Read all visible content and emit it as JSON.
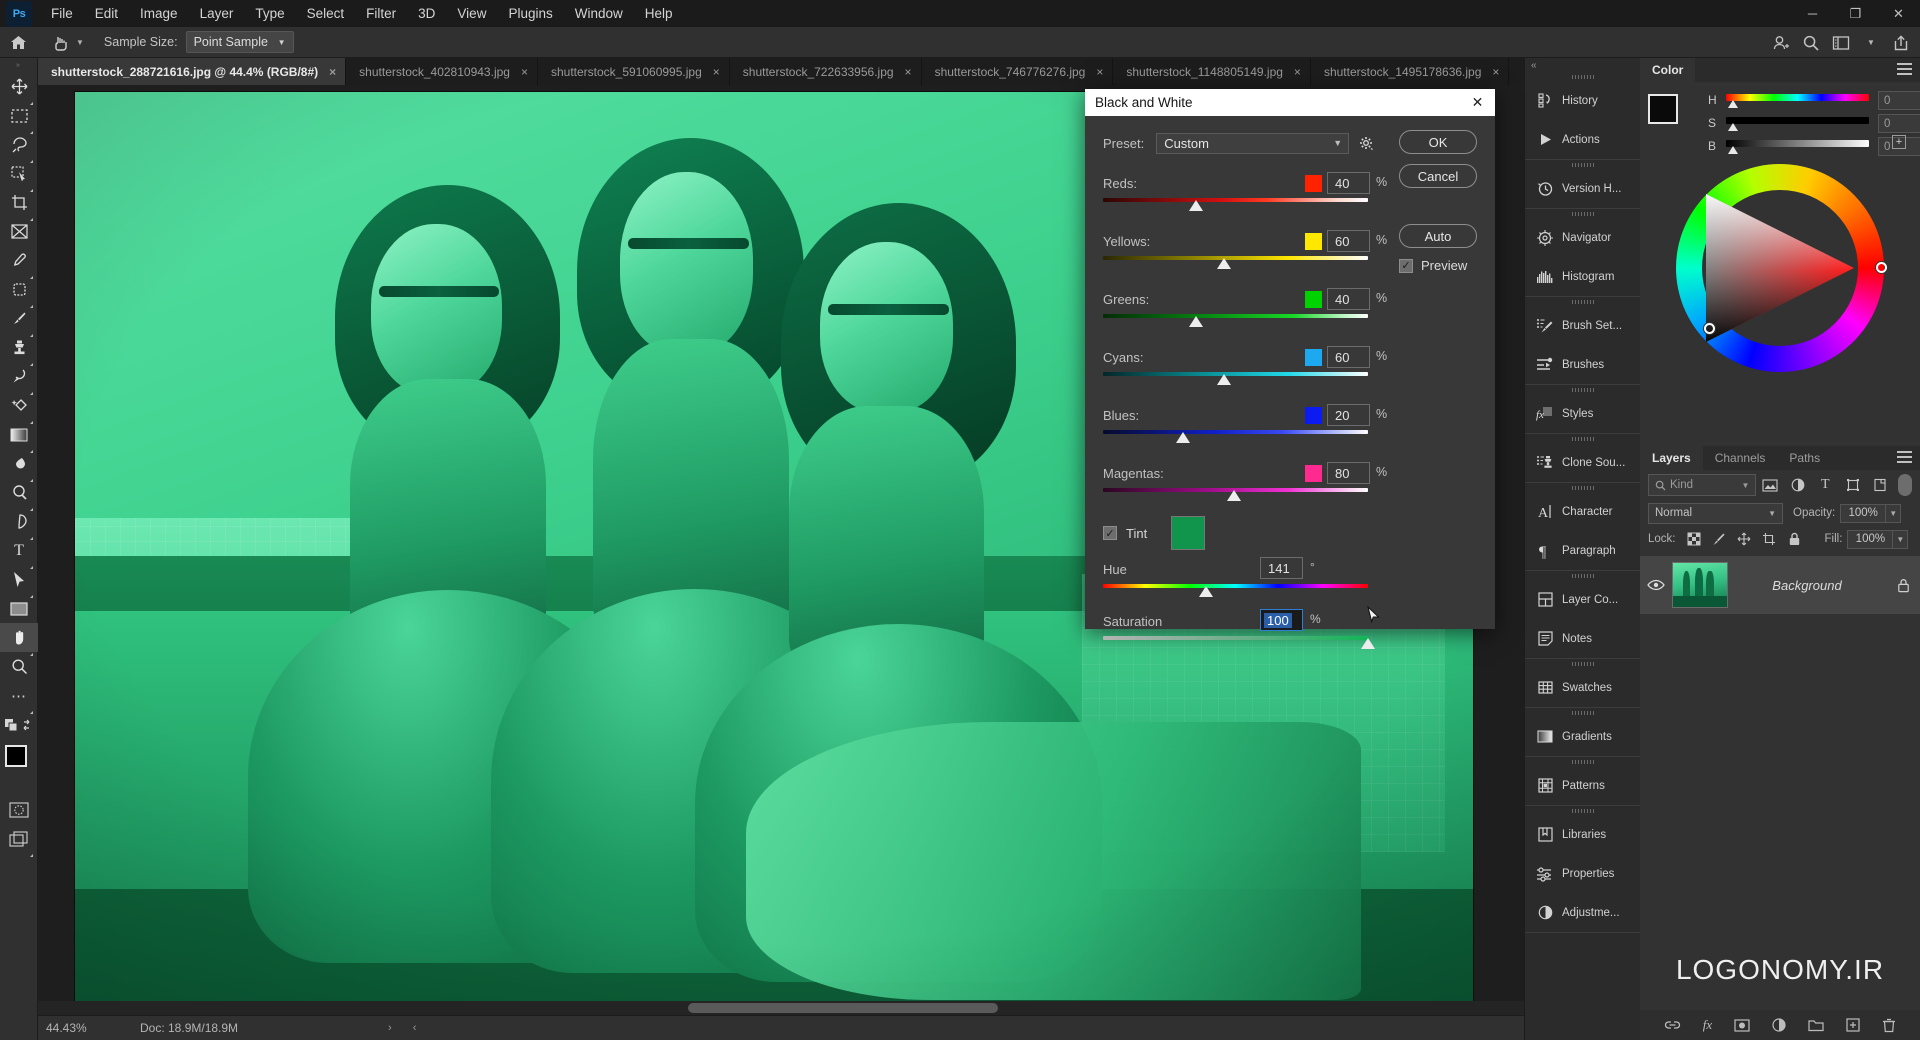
{
  "app": {
    "logo": "Ps",
    "menus": [
      "File",
      "Edit",
      "Image",
      "Layer",
      "Type",
      "Select",
      "Filter",
      "3D",
      "View",
      "Plugins",
      "Window",
      "Help"
    ],
    "window_controls": [
      "minimize-icon",
      "restore-icon",
      "close-icon"
    ]
  },
  "options_bar": {
    "home_icon": "home-icon",
    "tool_icon": "eyedropper-hand-icon",
    "sample_size_label": "Sample Size:",
    "sample_size_value": "Point Sample",
    "right_icons": [
      "user-add-icon",
      "search-icon",
      "workspace-icon",
      "chevron-down-icon",
      "share-icon"
    ]
  },
  "tabs": [
    {
      "label": "shutterstock_288721616.jpg @ 44.4% (RGB/8#)",
      "active": true,
      "close": "×"
    },
    {
      "label": "shutterstock_402810943.jpg",
      "active": false,
      "close": "×"
    },
    {
      "label": "shutterstock_591060995.jpg",
      "active": false,
      "close": "×"
    },
    {
      "label": "shutterstock_722633956.jpg",
      "active": false,
      "close": "×"
    },
    {
      "label": "shutterstock_746776276.jpg",
      "active": false,
      "close": "×"
    },
    {
      "label": "shutterstock_1148805149.jpg",
      "active": false,
      "close": "×"
    },
    {
      "label": "shutterstock_1495178636.jpg",
      "active": false,
      "close": "×"
    }
  ],
  "toolbar": {
    "tools": [
      {
        "name": "move-tool",
        "glyph": "✥",
        "sub": true,
        "selected": false
      },
      {
        "name": "rectangular-marquee-tool",
        "glyph": "⬚",
        "sub": true,
        "selected": false
      },
      {
        "name": "lasso-tool",
        "glyph": "☄",
        "sub": true,
        "selected": false
      },
      {
        "name": "object-selection-tool",
        "glyph": "⬚",
        "sub": true,
        "selected": false
      },
      {
        "name": "crop-tool",
        "glyph": "⌙",
        "sub": true,
        "selected": false
      },
      {
        "name": "frame-tool",
        "glyph": "⊠",
        "sub": false,
        "selected": false
      },
      {
        "name": "eyedropper-tool",
        "glyph": "✒",
        "sub": true,
        "selected": false
      },
      {
        "name": "spot-healing-brush-tool",
        "glyph": "⬚",
        "sub": true,
        "selected": false
      },
      {
        "name": "brush-tool",
        "glyph": "✎",
        "sub": true,
        "selected": false
      },
      {
        "name": "clone-stamp-tool",
        "glyph": "♟",
        "sub": true,
        "selected": false
      },
      {
        "name": "history-brush-tool",
        "glyph": "➰",
        "sub": true,
        "selected": false
      },
      {
        "name": "eraser-tool",
        "glyph": "✦",
        "sub": true,
        "selected": false
      },
      {
        "name": "gradient-tool",
        "glyph": "■",
        "sub": true,
        "selected": false
      },
      {
        "name": "blur-tool",
        "glyph": "◖",
        "sub": true,
        "selected": false
      },
      {
        "name": "dodge-tool",
        "glyph": "◔",
        "sub": true,
        "selected": false
      },
      {
        "name": "pen-tool",
        "glyph": "✒",
        "sub": true,
        "selected": false
      },
      {
        "name": "horizontal-type-tool",
        "glyph": "T",
        "sub": true,
        "selected": false
      },
      {
        "name": "path-selection-tool",
        "glyph": "➤",
        "sub": true,
        "selected": false
      },
      {
        "name": "rectangle-tool",
        "glyph": "▬",
        "sub": true,
        "selected": false
      },
      {
        "name": "hand-tool",
        "glyph": "✋",
        "sub": true,
        "selected": true
      },
      {
        "name": "zoom-tool",
        "glyph": "⚲",
        "sub": false,
        "selected": false
      },
      {
        "name": "edit-toolbar-ellipsis",
        "glyph": "…",
        "sub": true,
        "selected": false
      }
    ],
    "foreground_color": "#000000",
    "background_color": "#ffffff",
    "quick_mask_icon": "quick-mask-icon",
    "screen_mode_icon": "screen-mode-icon"
  },
  "dialog": {
    "title": "Black and White",
    "close_glyph": "✕",
    "preset_label": "Preset:",
    "preset_value": "Custom",
    "gear_icon": "gear-icon",
    "buttons": {
      "ok": "OK",
      "cancel": "Cancel",
      "auto": "Auto"
    },
    "preview_label": "Preview",
    "preview_checked": true,
    "channels": [
      {
        "label": "Reds:",
        "value": "40",
        "unit": "%",
        "chip": "#ff2200",
        "pos_pct": 35,
        "gradient": "linear-gradient(90deg,#2b0505,#d41010 45%,#ff3b24 62%,#ffd6cc 88%,#ffffff)"
      },
      {
        "label": "Yellows:",
        "value": "60",
        "unit": "%",
        "chip": "#ffe800",
        "pos_pct": 46,
        "gradient": "linear-gradient(90deg,#2a2705,#8f8500 35%,#ffe600 70%,#fff6b0 90%,#ffffff)"
      },
      {
        "label": "Greens:",
        "value": "40",
        "unit": "%",
        "chip": "#00d200",
        "pos_pct": 35,
        "gradient": "linear-gradient(90deg,#032b06,#068b12 40%,#18d827 72%,#c5f7cc 92%,#ffffff)"
      },
      {
        "label": "Cyans:",
        "value": "60",
        "unit": "%",
        "chip": "#1ca9f0",
        "pos_pct": 46,
        "gradient": "linear-gradient(90deg,#042628,#0a8d93 38%,#22d8e8 70%,#c3f4f8 92%,#ffffff)"
      },
      {
        "label": "Blues:",
        "value": "20",
        "unit": "%",
        "chip": "#0c1cf0",
        "pos_pct": 30,
        "gradient": "linear-gradient(90deg,#060a2c,#1020c8 42%,#3a4bf5 68%,#ccd2fb 92%,#ffffff)"
      },
      {
        "label": "Magentas:",
        "value": "80",
        "unit": "%",
        "chip": "#ff2a8f",
        "pos_pct": 50,
        "gradient": "linear-gradient(90deg,#2a0620,#a00c8a 40%,#f032d4 70%,#fbcaf2 92%,#ffffff)"
      }
    ],
    "tint": {
      "label": "Tint",
      "checked": true,
      "swatch_color": "#11954c"
    },
    "hue": {
      "label": "Hue",
      "value": "141",
      "unit": "°",
      "pos_pct": 39,
      "gradient": "linear-gradient(90deg,#ff0000,#ffff00 16%,#00ff00 33%,#00ffff 50%,#0000ff 66%,#ff00ff 83%,#ff0000)"
    },
    "saturation": {
      "label": "Saturation",
      "value": "100",
      "unit": "%",
      "pos_pct": 100,
      "gradient": "linear-gradient(90deg,#b4b4b4,#6fae8c 50%,#11b557 100%)"
    }
  },
  "dock_rail": {
    "collapse_icon": "double-chevron-right-icon",
    "groups": [
      [
        {
          "label": "History",
          "icon": "history-icon"
        },
        {
          "label": "Actions",
          "icon": "actions-play-icon"
        }
      ],
      [
        {
          "label": "Version H...",
          "icon": "version-history-icon"
        }
      ],
      [
        {
          "label": "Navigator",
          "icon": "navigator-icon"
        },
        {
          "label": "Histogram",
          "icon": "histogram-icon"
        }
      ],
      [
        {
          "label": "Brush Set...",
          "icon": "brush-settings-icon"
        },
        {
          "label": "Brushes",
          "icon": "brushes-icon"
        }
      ],
      [
        {
          "label": "Styles",
          "icon": "styles-fx-icon"
        }
      ],
      [
        {
          "label": "Clone Sou...",
          "icon": "clone-source-icon"
        }
      ],
      [
        {
          "label": "Character",
          "icon": "character-icon"
        },
        {
          "label": "Paragraph",
          "icon": "paragraph-icon"
        }
      ],
      [
        {
          "label": "Layer Co...",
          "icon": "layer-comps-icon"
        },
        {
          "label": "Notes",
          "icon": "notes-icon"
        }
      ],
      [
        {
          "label": "Swatches",
          "icon": "swatches-grid-icon"
        }
      ],
      [
        {
          "label": "Gradients",
          "icon": "gradients-icon"
        }
      ],
      [
        {
          "label": "Patterns",
          "icon": "patterns-icon"
        }
      ],
      [
        {
          "label": "Libraries",
          "icon": "libraries-icon"
        },
        {
          "label": "Properties",
          "icon": "properties-icon"
        },
        {
          "label": "Adjustme...",
          "icon": "adjustments-icon"
        }
      ]
    ]
  },
  "color_panel": {
    "tab": "Color",
    "menu_icon": "panel-menu-icon",
    "foreground": "#0a0a0a",
    "background": "#ffffff",
    "sliders": [
      {
        "label": "H",
        "value": "0",
        "unit": "°",
        "pos_pct": 2
      },
      {
        "label": "S",
        "value": "0",
        "unit": "%",
        "pos_pct": 2
      },
      {
        "label": "B",
        "value": "0",
        "unit": "%",
        "pos_pct": 2
      }
    ],
    "add_swatch_icon": "add-swatch-icon"
  },
  "layers_panel": {
    "tabs": [
      "Layers",
      "Channels",
      "Paths"
    ],
    "active_tab": "Layers",
    "menu_icon": "panel-menu-icon",
    "filter_kind": "Kind",
    "filter_icons": [
      "pixel-filter-icon",
      "adjustment-filter-icon",
      "type-filter-icon",
      "shape-filter-icon",
      "smart-object-filter-icon"
    ],
    "filter_toggle": "filter-toggle",
    "blend_mode": "Normal",
    "opacity_label": "Opacity:",
    "opacity_value": "100%",
    "lock_label": "Lock:",
    "lock_icons": [
      "lock-transparent-pixels-icon",
      "lock-image-pixels-icon",
      "lock-position-icon",
      "lock-artboard-icon",
      "lock-all-icon"
    ],
    "fill_label": "Fill:",
    "fill_value": "100%",
    "layers": [
      {
        "name": "Background",
        "visible": true,
        "locked": true,
        "eye_icon": "eye-icon",
        "lock_icon": "lock-icon"
      }
    ],
    "bottom_icons": [
      "link-layers-icon",
      "layer-fx-icon",
      "layer-mask-icon",
      "new-adjustment-layer-icon",
      "new-group-icon",
      "new-layer-icon",
      "delete-layer-icon"
    ]
  },
  "watermark": "LOGONOMY.IR",
  "status_bar": {
    "zoom": "44.43%",
    "doc_info": "Doc: 18.9M/18.9M",
    "arrows": "› ‹"
  }
}
